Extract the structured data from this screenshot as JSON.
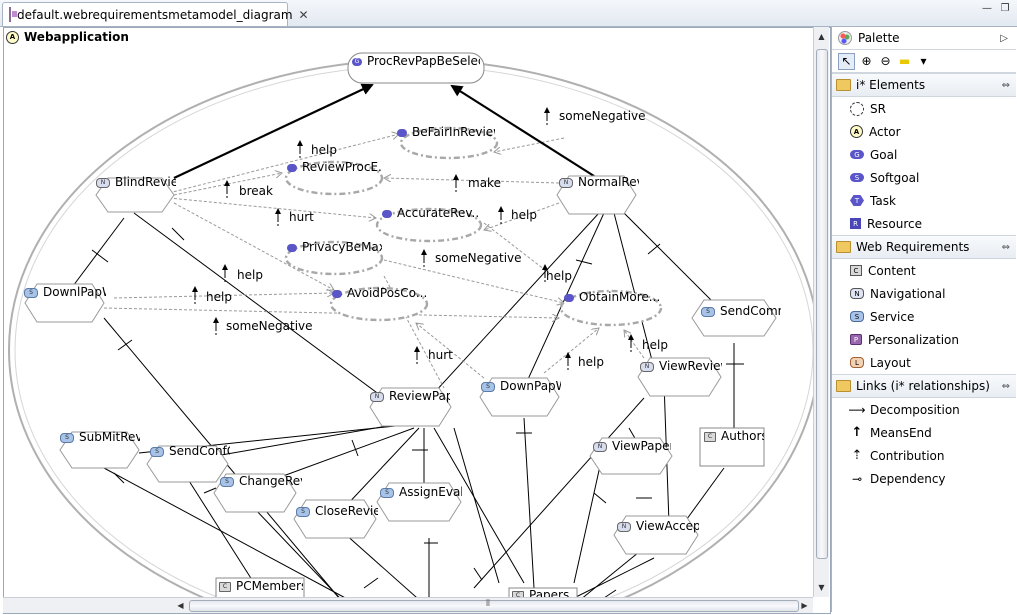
{
  "editor": {
    "tab_title": "default.webrequirementsmetamodel_diagram",
    "tab_close": "✕",
    "minimize": "—",
    "restore": "❐"
  },
  "diagram": {
    "actor_badge": "A",
    "actor_name": "Webapplication",
    "nodes": {
      "root": "ProcRevPapBeSelec...",
      "befair": "BeFairInReview",
      "reviewproc": "ReviewProcE...",
      "accurate": "AccurateRev...",
      "privacy": "PrivacyBeMax",
      "avoidpos": "AvoidPosCo...",
      "obtainmore": "ObtainMore...",
      "blindreview": "BlindReview",
      "normalrevi": "NormalRevi",
      "downlpapw": "DownlPapW",
      "sendcomm": "SendComm",
      "viewreview": "ViewReview",
      "reviewpape": "ReviewPape",
      "downpapw": "DownPapW",
      "submitrevi": "SubMitRevi",
      "sendconfc": "SendConfC",
      "changerev": "ChangeRev",
      "closereview": "CloseReview",
      "assigneval": "AssignEval",
      "viewpapers": "ViewPapers",
      "viewaccept": "ViewAccept",
      "authors": "Authors",
      "pcmembers": "PCMembers",
      "papers": "Papers"
    },
    "badges": {
      "goal": "G",
      "nav": "N",
      "svc": "S",
      "cnt": "C"
    },
    "link_labels": {
      "help1": "help",
      "break": "break",
      "hurt1": "hurt",
      "make": "make",
      "help2": "help",
      "someneg1": "someNegative",
      "help3": "help",
      "help4": "help",
      "someneg2": "someNegative",
      "help5": "help",
      "someneg3": "someNegative",
      "hurt2": "hurt",
      "help6": "help",
      "help7": "help"
    }
  },
  "palette": {
    "title": "Palette",
    "collapse": "▷",
    "tools": [
      "↖",
      "⊕",
      "⊖",
      "▬",
      "▾"
    ],
    "drawers": [
      {
        "label": "i* Elements",
        "pin": "⇔",
        "items": [
          {
            "label": "SR",
            "icon": "sr",
            "glyph": ""
          },
          {
            "label": "Actor",
            "icon": "actor",
            "glyph": "A"
          },
          {
            "label": "Goal",
            "icon": "goal",
            "glyph": "G"
          },
          {
            "label": "Softgoal",
            "icon": "softgoal",
            "glyph": "S"
          },
          {
            "label": "Task",
            "icon": "task",
            "glyph": "T"
          },
          {
            "label": "Resource",
            "icon": "resource",
            "glyph": "R"
          }
        ]
      },
      {
        "label": "Web Requirements",
        "pin": "⇔",
        "items": [
          {
            "label": "Content",
            "icon": "content",
            "glyph": "C"
          },
          {
            "label": "Navigational",
            "icon": "nav",
            "glyph": "N"
          },
          {
            "label": "Service",
            "icon": "svc",
            "glyph": "S"
          },
          {
            "label": "Personalization",
            "icon": "pers",
            "glyph": "P"
          },
          {
            "label": "Layout",
            "icon": "layout",
            "glyph": "L"
          }
        ]
      },
      {
        "label": "Links (i* relationships)",
        "pin": "⇔",
        "items": [
          {
            "label": "Decomposition",
            "icon": "decomp",
            "glyph": "⟶"
          },
          {
            "label": "MeansEnd",
            "icon": "meansend",
            "glyph": "↑"
          },
          {
            "label": "Contribution",
            "icon": "contrib",
            "glyph": "⇡"
          },
          {
            "label": "Dependency",
            "icon": "dep",
            "glyph": "⊸"
          }
        ]
      }
    ]
  },
  "scrollbars": {
    "up": "▲",
    "down": "▼",
    "left": "◀",
    "right": "▶",
    "grip": "⦀"
  }
}
